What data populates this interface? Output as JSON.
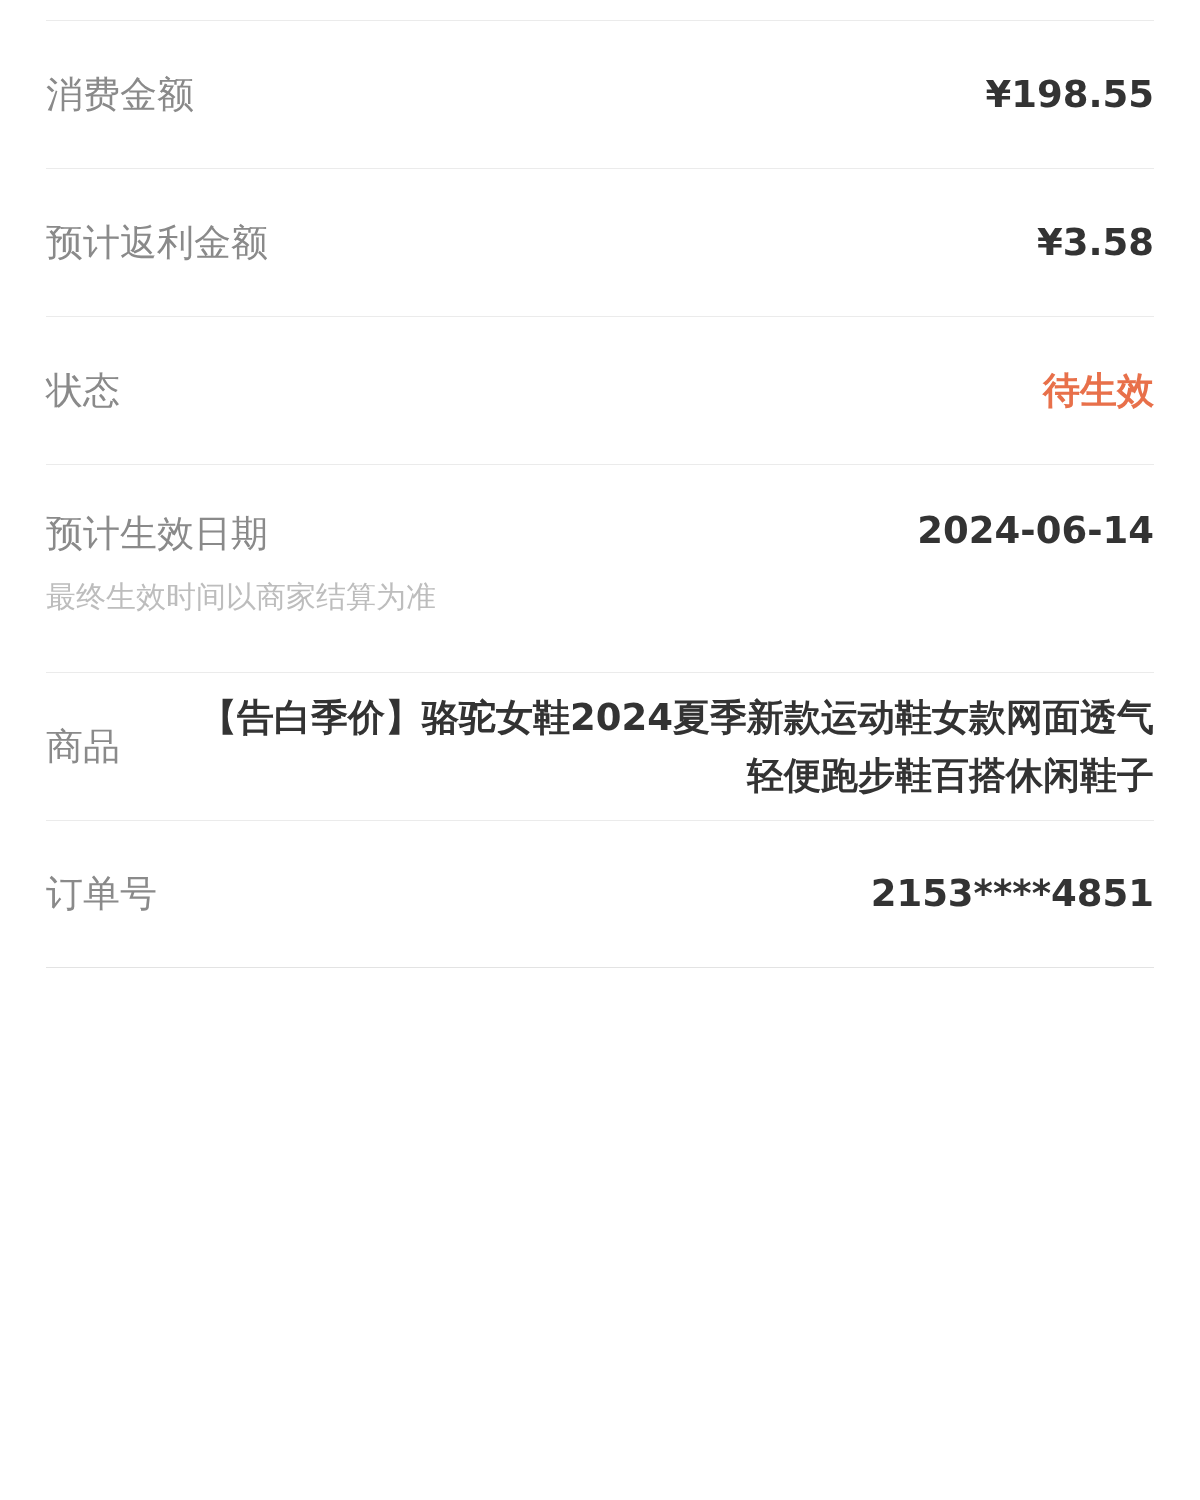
{
  "rows": [
    {
      "label": "消费金额",
      "value": "¥198.55"
    },
    {
      "label": "预计返利金额",
      "value": "¥3.58"
    },
    {
      "label": "状态",
      "value": "待生效",
      "color": "#e8704a"
    },
    {
      "label": "预计生效日期",
      "value": "2024-06-14",
      "note": "最终生效时间以商家结算为准"
    },
    {
      "label": "商品",
      "value": "【告白季价】骆驼女鞋2024夏季新款运动鞋女款网面透气轻便跑步鞋百搭休闲鞋子"
    },
    {
      "label": "订单号",
      "value": "2153****4851"
    }
  ]
}
